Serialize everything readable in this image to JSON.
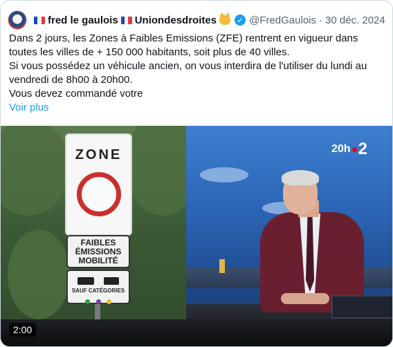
{
  "tweet": {
    "display_name_part1": "fred le gaulois",
    "display_name_part2": "Uniondesdroites",
    "handle": "@FredGaulois",
    "separator": "·",
    "date": "30 déc. 2024",
    "text_lines": [
      "Dans 2 jours, les Zones à Faibles Emissions (ZFE) rentrent en vigueur dans",
      "toutes les villes de + 150 000 habitants, soit plus de 40 villes.",
      "Si vous possédez un véhicule ancien, on vous interdira de l'utiliser du lundi au",
      "vendredi de 8h00 à 20h00.",
      "Vous devez commandé votre"
    ],
    "show_more": "Voir plus"
  },
  "media": {
    "duration": "2:00",
    "sign_zone": "ZONE",
    "sign_zfe_lines": [
      "FAIBLES",
      "ÉMISSIONS",
      "MOBILITÉ"
    ],
    "sign_exception": "SAUF CATÉGORIES",
    "channel_logo_time": "20h",
    "channel_logo_number": "2"
  },
  "colors": {
    "link": "#1d9bf0",
    "verified_badge": "#1d9bf0",
    "handle_gray": "#536471",
    "sign_red": "#c9302c",
    "logo_dot": "#e2001a"
  },
  "icons": [
    "avatar",
    "flag-france-icon",
    "cat-emoji-icon",
    "verified-badge-icon"
  ]
}
